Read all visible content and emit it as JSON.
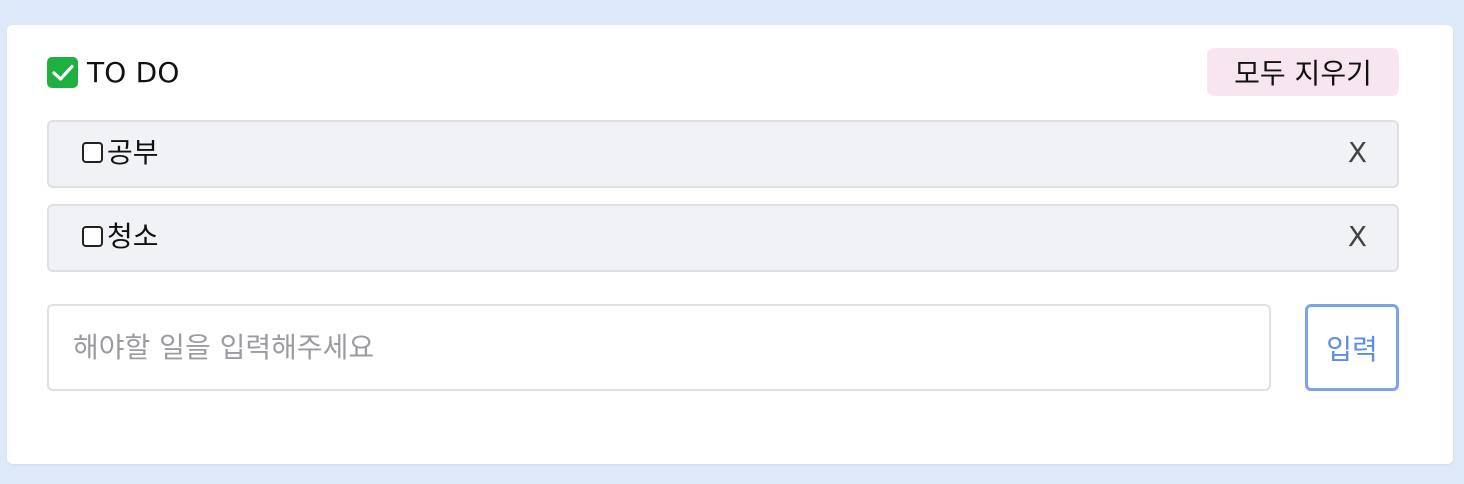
{
  "header": {
    "title_icon": "check-mark-icon",
    "title": "TO DO",
    "clear_all_label": "모두 지우기"
  },
  "todos": [
    {
      "text": "공부",
      "done": false,
      "delete_label": "X"
    },
    {
      "text": "청소",
      "done": false,
      "delete_label": "X"
    }
  ],
  "input": {
    "value": "",
    "placeholder": "해야할 일을 입력해주세요",
    "submit_label": "입력"
  },
  "colors": {
    "page_background": "#dde8f9",
    "card_background": "#ffffff",
    "check_icon": "#1fb140",
    "clear_button_bg": "#f7e6ef",
    "item_background": "#f1f2f5",
    "submit_border": "#78a5ea",
    "submit_text": "#5b8ee0"
  }
}
